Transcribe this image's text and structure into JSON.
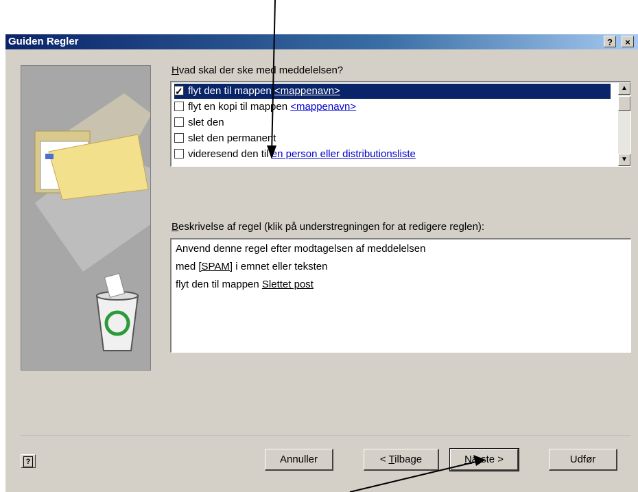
{
  "window": {
    "title": "Guiden Regler",
    "help_button": "?",
    "close_button": "×"
  },
  "actions": {
    "label_prefix": "H",
    "label_rest": "vad skal der ske med meddelelsen?",
    "items": [
      {
        "text": "flyt den til mappen ",
        "link": "<mappenavn>",
        "checked": true,
        "selected": true
      },
      {
        "text": "flyt en kopi til mappen ",
        "link": "<mappenavn>",
        "checked": false,
        "selected": false
      },
      {
        "text": "slet den",
        "link": "",
        "checked": false,
        "selected": false
      },
      {
        "text": "slet den permanent",
        "link": "",
        "checked": false,
        "selected": false
      },
      {
        "text": "videresend den til ",
        "link": "en person eller distributionsliste",
        "checked": false,
        "selected": false
      }
    ]
  },
  "description": {
    "label_prefix": "B",
    "label_rest": "eskrivelse af regel (klik på understregningen for at redigere reglen):",
    "line1": "Anvend denne regel efter modtagelsen af meddelelsen",
    "line2_pre": "med ",
    "line2_link": "[SPAM]",
    "line2_post": " i emnet eller teksten",
    "line3_pre": "flyt den til mappen ",
    "line3_link": "Slettet post"
  },
  "buttons": {
    "help": "?",
    "cancel": "Annuller",
    "back_pre": "< ",
    "back_u": "T",
    "back_post": "ilbage",
    "next_pre": "N",
    "next_post": "æste >",
    "finish": "Udfør"
  }
}
